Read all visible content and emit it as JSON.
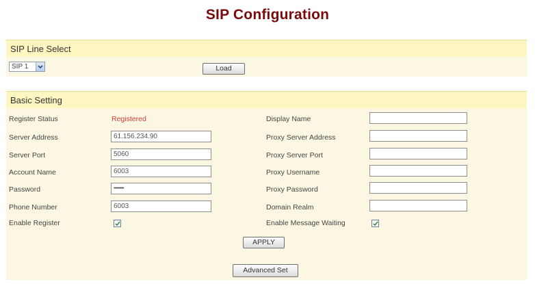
{
  "page": {
    "title": "SIP Configuration"
  },
  "line_select": {
    "header": "SIP Line Select",
    "selected": "SIP 1",
    "load_label": "Load"
  },
  "basic": {
    "header": "Basic Setting",
    "register_status_label": "Register Status",
    "register_status_value": "Registered",
    "server_address_label": "Server Address",
    "server_address_value": "61.156.234.90",
    "server_port_label": "Server Port",
    "server_port_value": "5060",
    "account_name_label": "Account Name",
    "account_name_value": "6003",
    "password_label": "Password",
    "password_value": "••••••••••",
    "phone_number_label": "Phone Number",
    "phone_number_value": "6003",
    "enable_register_label": "Enable Register",
    "enable_register_checked": true,
    "display_name_label": "Display Name",
    "display_name_value": "",
    "proxy_server_address_label": "Proxy Server Address",
    "proxy_server_address_value": "",
    "proxy_server_port_label": "Proxy Server Port",
    "proxy_server_port_value": "",
    "proxy_username_label": "Proxy Username",
    "proxy_username_value": "",
    "proxy_password_label": "Proxy Password",
    "proxy_password_value": "",
    "domain_realm_label": "Domain Realm",
    "domain_realm_value": "",
    "enable_mwi_label": "Enable Message Waiting",
    "enable_mwi_checked": true,
    "apply_label": "APPLY",
    "advanced_label": "Advanced Set"
  },
  "colors": {
    "title": "#7a0a0a",
    "header_bg": "#fdf6c0",
    "panel_bg": "#fbf7e3",
    "status_registered": "#d23a3a"
  }
}
